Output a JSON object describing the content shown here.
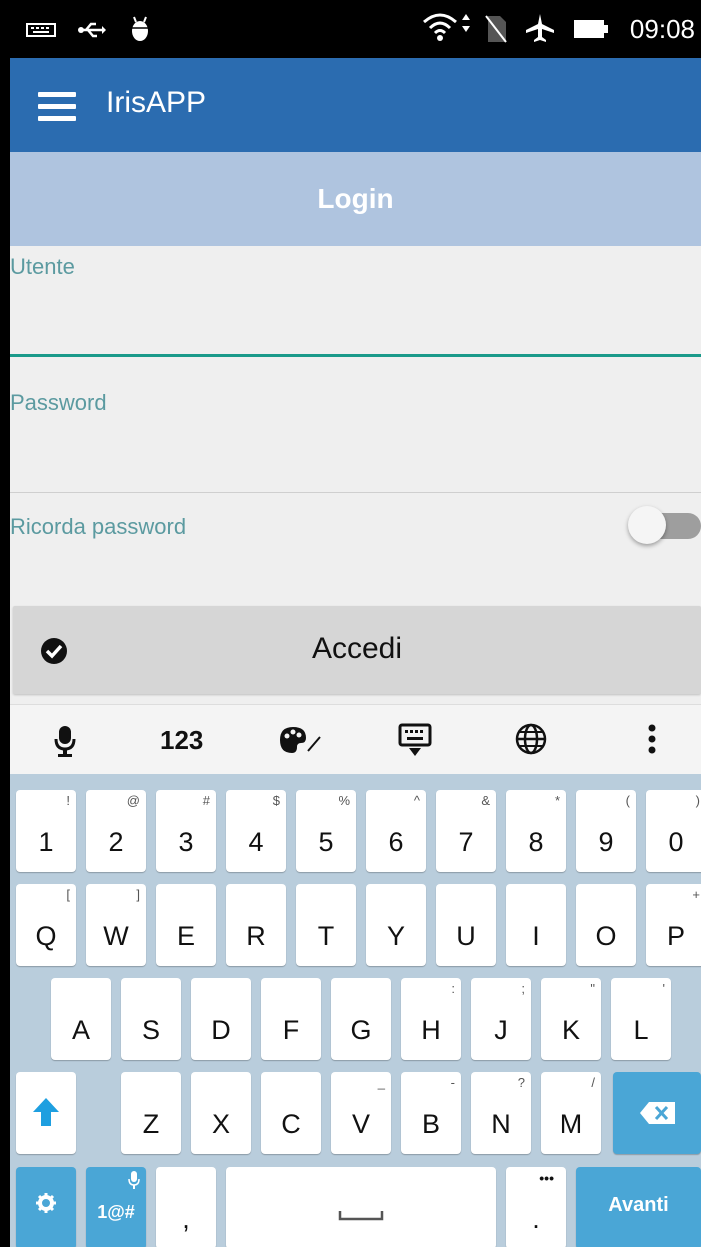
{
  "status_bar": {
    "time": "09:08"
  },
  "app_bar": {
    "title": "IrisAPP"
  },
  "header": {
    "title": "Login"
  },
  "form": {
    "user_label": "Utente",
    "password_label": "Password",
    "remember_label": "Ricorda password",
    "remember_on": false,
    "submit_label": "Accedi"
  },
  "keyboard": {
    "toolbar_numbers": "123",
    "number_row": [
      {
        "main": "1",
        "alt": "!"
      },
      {
        "main": "2",
        "alt": "@"
      },
      {
        "main": "3",
        "alt": "#"
      },
      {
        "main": "4",
        "alt": "$"
      },
      {
        "main": "5",
        "alt": "%"
      },
      {
        "main": "6",
        "alt": "^"
      },
      {
        "main": "7",
        "alt": "&"
      },
      {
        "main": "8",
        "alt": "*"
      },
      {
        "main": "9",
        "alt": "("
      },
      {
        "main": "0",
        "alt": ")"
      }
    ],
    "row1": [
      {
        "main": "Q",
        "alt": "["
      },
      {
        "main": "W",
        "alt": "]"
      },
      {
        "main": "E",
        "alt": ""
      },
      {
        "main": "R",
        "alt": ""
      },
      {
        "main": "T",
        "alt": ""
      },
      {
        "main": "Y",
        "alt": ""
      },
      {
        "main": "U",
        "alt": ""
      },
      {
        "main": "I",
        "alt": ""
      },
      {
        "main": "O",
        "alt": ""
      },
      {
        "main": "P",
        "alt": "+"
      }
    ],
    "row2": [
      {
        "main": "A",
        "alt": ""
      },
      {
        "main": "S",
        "alt": ""
      },
      {
        "main": "D",
        "alt": ""
      },
      {
        "main": "F",
        "alt": ""
      },
      {
        "main": "G",
        "alt": ""
      },
      {
        "main": "H",
        "alt": ":"
      },
      {
        "main": "J",
        "alt": ";"
      },
      {
        "main": "K",
        "alt": "\""
      },
      {
        "main": "L",
        "alt": "'"
      }
    ],
    "row3": [
      {
        "main": "Z",
        "alt": ""
      },
      {
        "main": "X",
        "alt": ""
      },
      {
        "main": "C",
        "alt": ""
      },
      {
        "main": "V",
        "alt": "_"
      },
      {
        "main": "B",
        "alt": "-"
      },
      {
        "main": "N",
        "alt": "?"
      },
      {
        "main": "M",
        "alt": "/"
      }
    ],
    "symbols_key": "1@#",
    "comma_key": ",",
    "period_key": ".",
    "period_alt": "•••",
    "action_key": "Avanti"
  },
  "colors": {
    "app_bar": "#2b6cb0",
    "header": "#afc4df",
    "accent": "#1a9a8a",
    "key_blue": "#4aa6d6"
  }
}
